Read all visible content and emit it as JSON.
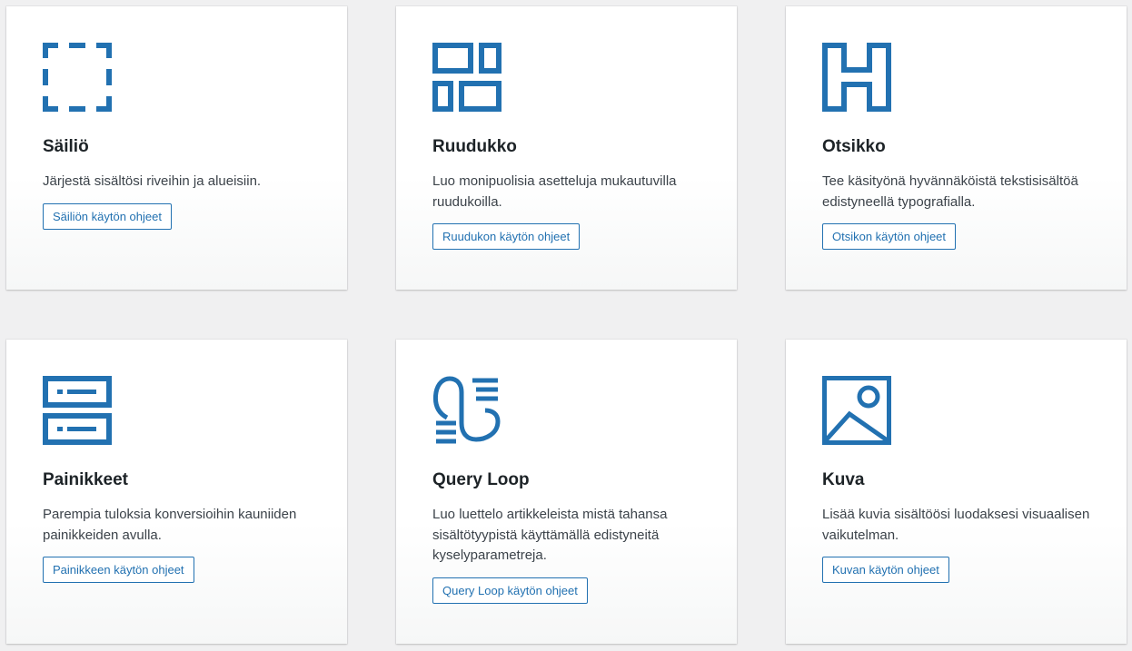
{
  "accent_color": "#2271b1",
  "cards": [
    {
      "icon": "container-icon",
      "title": "Säiliö",
      "description": "Järjestä sisältösi riveihin ja alueisiin.",
      "button": "Säiliön käytön ohjeet"
    },
    {
      "icon": "grid-icon",
      "title": "Ruudukko",
      "description": "Luo monipuolisia asetteluja mukautuvilla ruudukoilla.",
      "button": "Ruudukon käytön ohjeet"
    },
    {
      "icon": "headline-icon",
      "title": "Otsikko",
      "description": "Tee käsityönä hyvännäköistä tekstisisältöä edistyneellä typografialla.",
      "button": "Otsikon käytön ohjeet"
    },
    {
      "icon": "buttons-icon",
      "title": "Painikkeet",
      "description": "Parempia tuloksia konversioihin kauniiden painikkeiden avulla.",
      "button": "Painikkeen käytön ohjeet"
    },
    {
      "icon": "query-loop-icon",
      "title": "Query Loop",
      "description": "Luo luettelo artikkeleista mistä tahansa sisältötyypistä käyttämällä edistyneitä kyselyparametreja.",
      "button": "Query Loop käytön ohjeet"
    },
    {
      "icon": "image-icon",
      "title": "Kuva",
      "description": "Lisää kuvia sisältöösi luodaksesi visuaalisen vaikutelman.",
      "button": "Kuvan käytön ohjeet"
    }
  ]
}
